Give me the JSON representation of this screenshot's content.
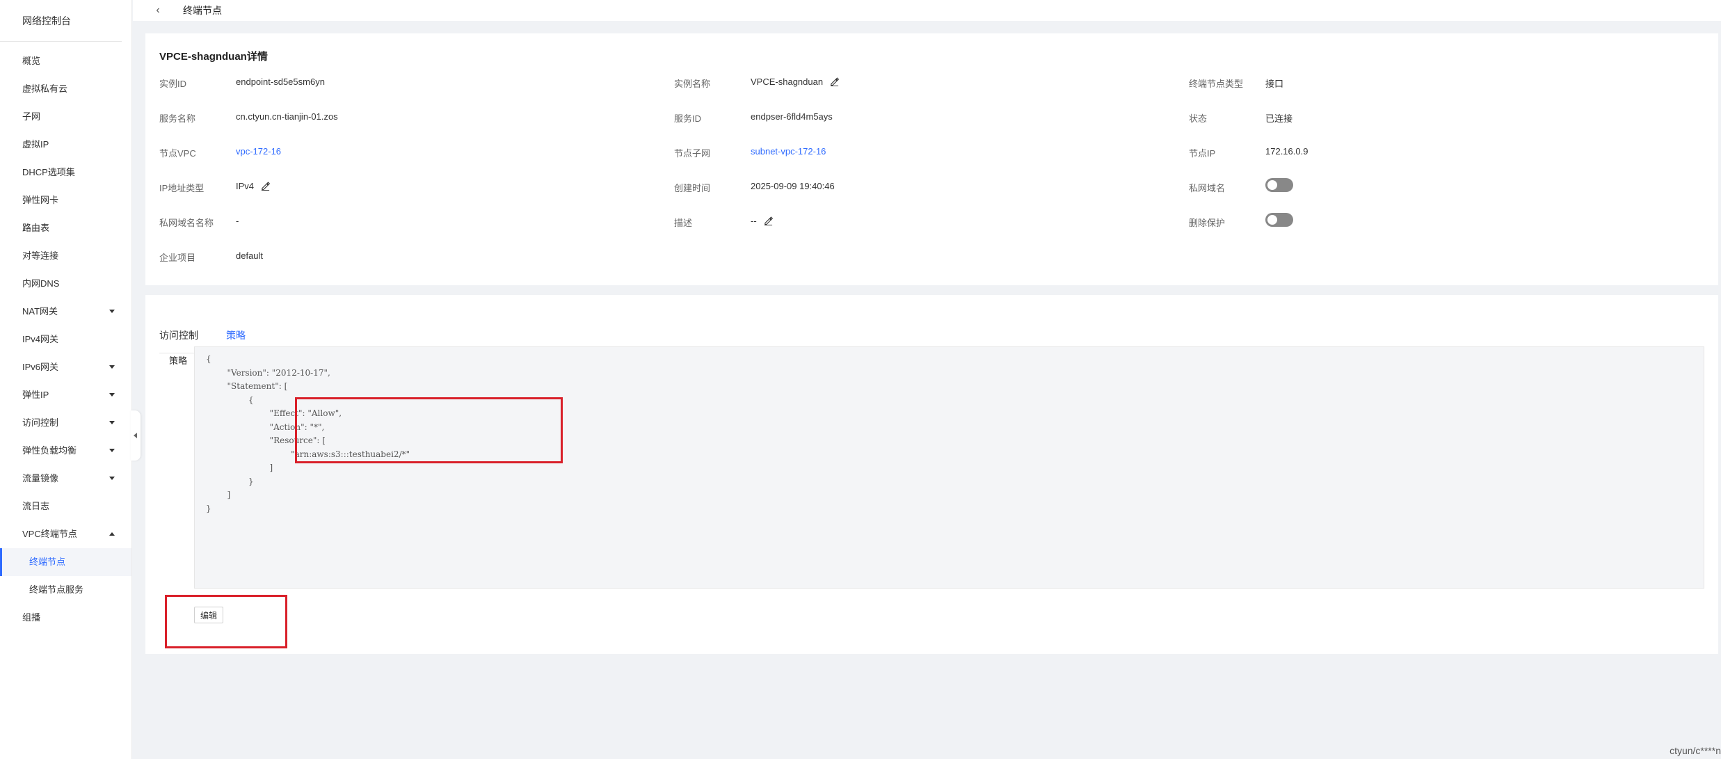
{
  "sidebar": {
    "title": "网络控制台",
    "items": [
      {
        "label": "概览"
      },
      {
        "label": "虚拟私有云"
      },
      {
        "label": "子网"
      },
      {
        "label": "虚拟IP"
      },
      {
        "label": "DHCP选项集"
      },
      {
        "label": "弹性网卡"
      },
      {
        "label": "路由表"
      },
      {
        "label": "对等连接"
      },
      {
        "label": "内网DNS"
      },
      {
        "label": "NAT网关"
      },
      {
        "label": "IPv4网关"
      },
      {
        "label": "IPv6网关"
      },
      {
        "label": "弹性IP"
      },
      {
        "label": "访问控制"
      },
      {
        "label": "弹性负载均衡"
      },
      {
        "label": "流量镜像"
      },
      {
        "label": "流日志"
      },
      {
        "label": "VPC终端节点"
      },
      {
        "label": "终端节点"
      },
      {
        "label": "终端节点服务"
      },
      {
        "label": "组播"
      }
    ]
  },
  "header": {
    "title": "终端节点"
  },
  "detail": {
    "title": "VPCE-shagnduan详情",
    "instance_id": {
      "label": "实例ID",
      "value": "endpoint-sd5e5sm6yn"
    },
    "instance_name": {
      "label": "实例名称",
      "value": "VPCE-shagnduan"
    },
    "endpoint_type": {
      "label": "终端节点类型",
      "value": "接口"
    },
    "service_name": {
      "label": "服务名称",
      "value": "cn.ctyun.cn-tianjin-01.zos"
    },
    "service_id": {
      "label": "服务ID",
      "value": "endpser-6fld4m5ays"
    },
    "status": {
      "label": "状态",
      "value": "已连接"
    },
    "node_vpc": {
      "label": "节点VPC",
      "value": "vpc-172-16"
    },
    "node_subnet": {
      "label": "节点子网",
      "value": "subnet-vpc-172-16"
    },
    "node_ip": {
      "label": "节点IP",
      "value": "172.16.0.9"
    },
    "ip_type": {
      "label": "IP地址类型",
      "value": "IPv4"
    },
    "created": {
      "label": "创建时间",
      "value": "2025-09-09 19:40:46"
    },
    "private_dns": {
      "label": "私网域名",
      "enabled": false
    },
    "private_dns_name": {
      "label": "私网域名名称",
      "value": "-"
    },
    "description": {
      "label": "描述",
      "value": "--"
    },
    "delete_protection": {
      "label": "删除保护",
      "enabled": false
    },
    "project": {
      "label": "企业项目",
      "value": "default"
    }
  },
  "policy": {
    "tabs": [
      {
        "label": "访问控制"
      },
      {
        "label": "策略"
      }
    ],
    "label": "策略",
    "content": "{\n        \"Version\": \"2012-10-17\",\n        \"Statement\": [\n                {\n                        \"Effect\": \"Allow\",\n                        \"Action\": \"*\",\n                        \"Resource\": [\n                                \"arn:aws:s3:::testhuabei2/*\"\n                        ]\n                }\n        ]\n}",
    "edit_label": "编辑"
  },
  "watermark": "ctyun/c****n",
  "colors": {
    "accent": "#2f6bff",
    "highlight": "#d9202a"
  }
}
